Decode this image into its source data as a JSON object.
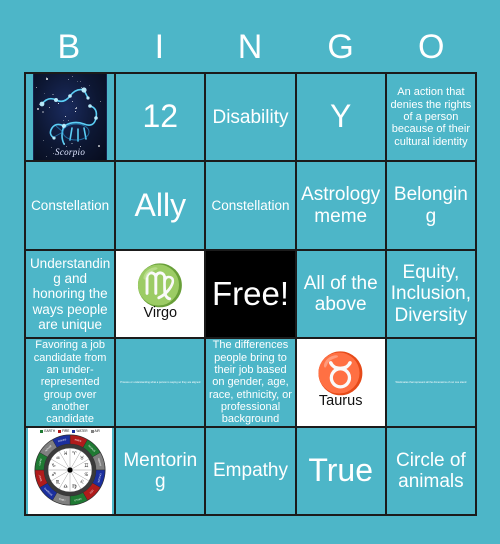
{
  "header": {
    "letters": [
      "B",
      "I",
      "N",
      "G",
      "O"
    ]
  },
  "colors": {
    "background": "#4db6c8",
    "cell_background": "#4db6c8",
    "grid_line": "#1b1b1b",
    "text": "#ffffff",
    "free_cell_background": "#000000",
    "zodiac_cell_background": "#ffffff",
    "legend_earth": "#1f7a33",
    "legend_fire": "#b01b1b",
    "legend_water": "#1b2f9e",
    "legend_air": "#808080"
  },
  "grid": {
    "rows": 5,
    "columns": 5,
    "cells": [
      {
        "row": 1,
        "col": 1,
        "type": "image",
        "image_name": "scorpio-constellation-image",
        "caption": "Scorpio",
        "text": ""
      },
      {
        "row": 1,
        "col": 2,
        "type": "text",
        "text": "12",
        "size": "xl"
      },
      {
        "row": 1,
        "col": 3,
        "type": "text",
        "text": "Disability",
        "size": "md"
      },
      {
        "row": 1,
        "col": 4,
        "type": "text",
        "text": "Y",
        "size": "xl"
      },
      {
        "row": 1,
        "col": 5,
        "type": "text",
        "text": "An action that denies the rights of a person because of their cultural identity",
        "size": "xs"
      },
      {
        "row": 2,
        "col": 1,
        "type": "text",
        "text": "Constellation",
        "size": "sm"
      },
      {
        "row": 2,
        "col": 2,
        "type": "text",
        "text": "Ally",
        "size": "xl"
      },
      {
        "row": 2,
        "col": 3,
        "type": "text",
        "text": "Constellation",
        "size": "sm"
      },
      {
        "row": 2,
        "col": 4,
        "type": "text",
        "text": "Astrology meme",
        "size": "md"
      },
      {
        "row": 2,
        "col": 5,
        "type": "text",
        "text": "Belonging",
        "size": "md"
      },
      {
        "row": 3,
        "col": 1,
        "type": "text",
        "text": "Understanding and honoring the ways people are unique",
        "size": "sm"
      },
      {
        "row": 3,
        "col": 2,
        "type": "zodiac",
        "glyph": "♍",
        "glyph_name": "virgo-symbol",
        "label": "Virgo",
        "text": ""
      },
      {
        "row": 3,
        "col": 3,
        "type": "free",
        "text": "Free!"
      },
      {
        "row": 3,
        "col": 4,
        "type": "text",
        "text": "All of the above",
        "size": "md"
      },
      {
        "row": 3,
        "col": 5,
        "type": "text",
        "text": "Equity, Inclusion, Diversity",
        "size": "md"
      },
      {
        "row": 4,
        "col": 1,
        "type": "text",
        "text": "Favoring a job candidate from an under-represented group over another candidate",
        "size": "xs"
      },
      {
        "row": 4,
        "col": 2,
        "type": "text",
        "text": "Process or understanding what a person is saying so they are aligned",
        "size": "tiny"
      },
      {
        "row": 4,
        "col": 3,
        "type": "text",
        "text": "The differences people bring to their job based on gender, age, race, ethnicity, or professional background",
        "size": "xs"
      },
      {
        "row": 4,
        "col": 4,
        "type": "zodiac",
        "glyph": "♉",
        "glyph_name": "taurus-symbol",
        "label": "Taurus",
        "text": ""
      },
      {
        "row": 4,
        "col": 5,
        "type": "text",
        "text": "Workmates that represent all the dimensions of our one stand",
        "size": "tiny"
      },
      {
        "row": 5,
        "col": 1,
        "type": "wheel",
        "image_name": "zodiac-wheel-chart",
        "legend": [
          "EARTH",
          "FIRE",
          "WATER",
          "AIR"
        ],
        "text": ""
      },
      {
        "row": 5,
        "col": 2,
        "type": "text",
        "text": "Mentoring",
        "size": "md"
      },
      {
        "row": 5,
        "col": 3,
        "type": "text",
        "text": "Empathy",
        "size": "md"
      },
      {
        "row": 5,
        "col": 4,
        "type": "text",
        "text": "True",
        "size": "xl"
      },
      {
        "row": 5,
        "col": 5,
        "type": "text",
        "text": "Circle of animals",
        "size": "md"
      }
    ]
  }
}
